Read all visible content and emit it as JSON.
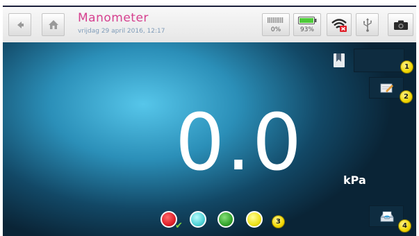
{
  "header": {
    "title": "Manometer",
    "datetime": "vrijdag 29 april 2016, 12:17",
    "memory_percent": "0%",
    "battery_percent": "93%"
  },
  "reading": {
    "value": "0.0",
    "unit": "kPa"
  },
  "callouts": [
    "1",
    "2",
    "3",
    "4"
  ],
  "color_options": [
    {
      "name": "red",
      "color": "#e0202a",
      "selected": true
    },
    {
      "name": "cyan",
      "color": "#4fd2d6",
      "selected": false
    },
    {
      "name": "green",
      "color": "#35a52d",
      "selected": false
    },
    {
      "name": "yellow",
      "color": "#f0e21a",
      "selected": false
    }
  ],
  "colors": {
    "title": "#d6408f",
    "accent_badge": "#f2d800",
    "screen_center": "#56c6ea",
    "screen_edge": "#0a2436"
  },
  "icons": [
    "back-arrow-icon",
    "home-icon",
    "memory-icon",
    "battery-icon",
    "wifi-off-icon",
    "usb-icon",
    "camera-icon",
    "bookmark-icon",
    "notes-icon",
    "save-tray-icon"
  ]
}
